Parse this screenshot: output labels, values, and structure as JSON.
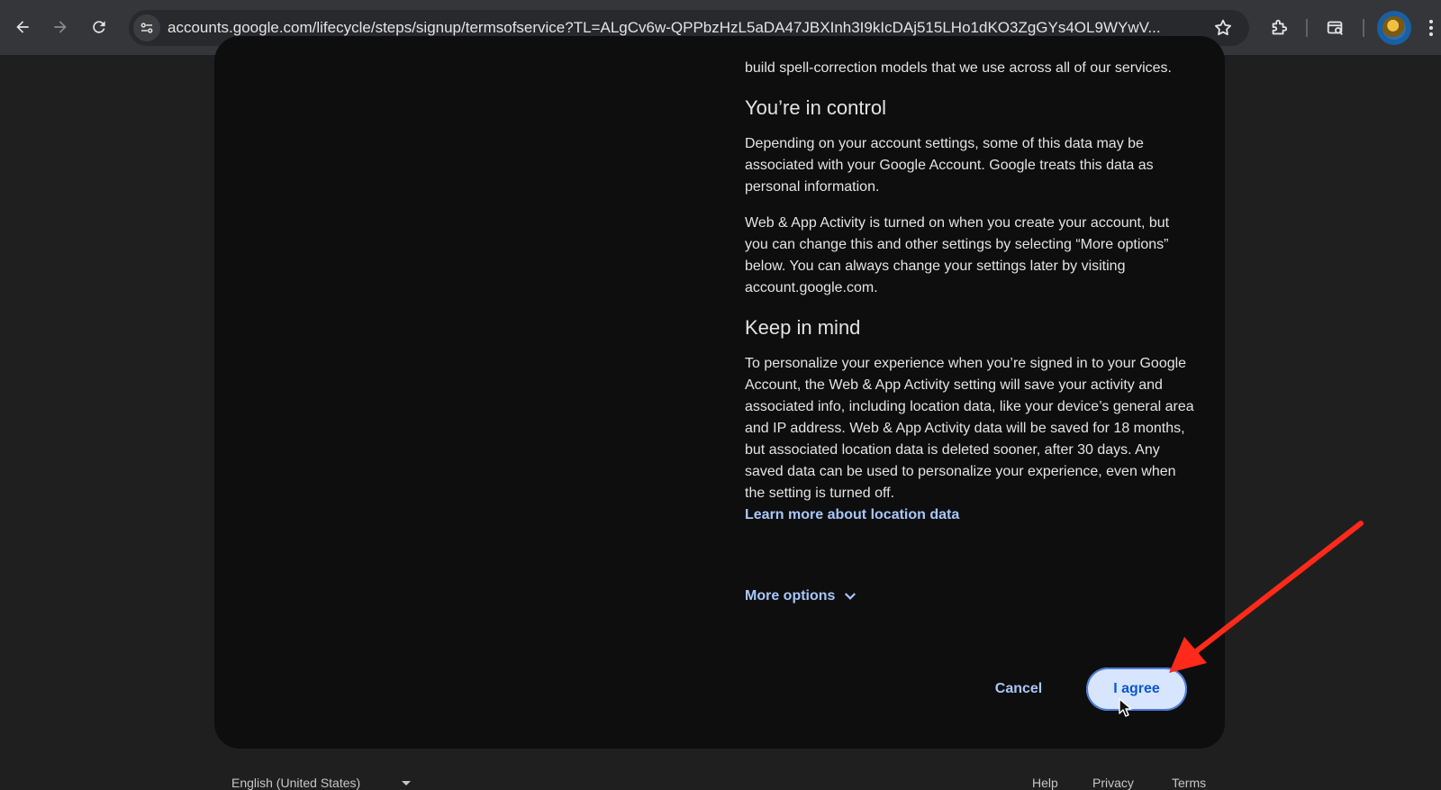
{
  "browser": {
    "url": "accounts.google.com/lifecycle/steps/signup/termsofservice?TL=ALgCv6w-QPPbzHzL5aDA47JBXInh3I9kIcDAj515LHo1dKO3ZgGYs4OL9WYwV...",
    "icons": [
      "back-arrow-icon",
      "forward-arrow-icon",
      "reload-icon",
      "site-info-icon",
      "star-icon",
      "extensions-icon",
      "tab-search-icon",
      "profile-avatar",
      "more-vert-icon"
    ]
  },
  "content": {
    "intro_tail": "build spell-correction models that we use across all of our services.",
    "section1_heading": "You’re in control",
    "section1_p1": "Depending on your account settings, some of this data may be associated with your Google Account. Google treats this data as personal information.",
    "section1_p2": "Web & App Activity is turned on when you create your account, but you can change this and other settings by selecting “More options” below. You can always change your settings later by visiting account.google.com.",
    "section2_heading": "Keep in mind",
    "section2_p1": "To personalize your experience when you’re signed in to your Google Account, the Web & App Activity setting will save your activity and associated info, including location data, like your device’s general area and IP address. Web & App Activity data will be saved for 18 months, but associated location data is deleted sooner, after 30 days. Any saved data can be used to personalize your experience, even when the setting is turned off.",
    "location_link": "Learn more about location data",
    "more_options": "More options"
  },
  "actions": {
    "cancel": "Cancel",
    "agree": "I agree"
  },
  "footer": {
    "language": "English (United States)",
    "help": "Help",
    "privacy": "Privacy",
    "terms": "Terms"
  },
  "colors": {
    "accent": "#a8c7fa",
    "agree_bg": "#d7e5ff",
    "annotation_arrow": "#ff2a1a"
  }
}
